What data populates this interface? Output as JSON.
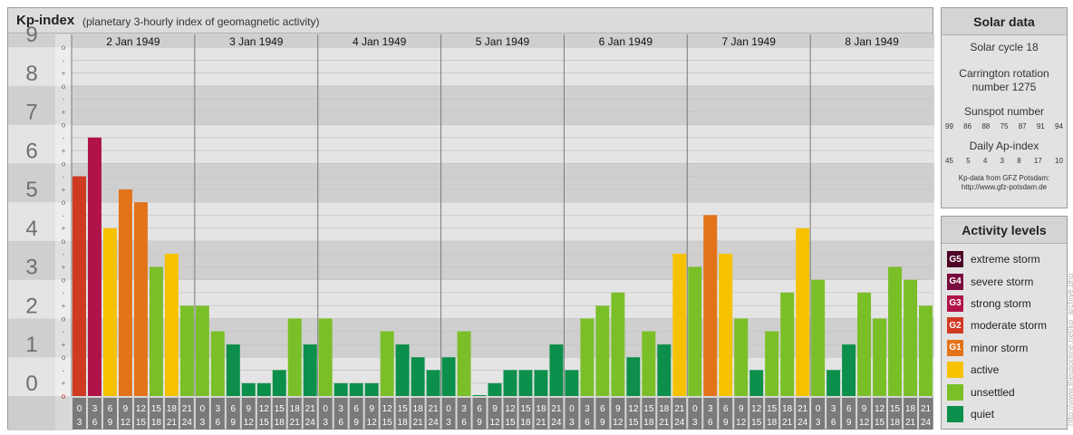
{
  "header": {
    "title": "Kp-index",
    "subtitle": "(planetary 3-hourly index of geomagnetic activity)"
  },
  "chart_data": {
    "type": "bar",
    "y_major_labels": [
      "0",
      "1",
      "2",
      "3",
      "4",
      "5",
      "6",
      "7",
      "8",
      "9"
    ],
    "y_minor_labels": [
      "o",
      "+",
      "-",
      "o",
      "+",
      "-",
      "o",
      "+",
      "-",
      "o",
      "+",
      "-",
      "o",
      "+",
      "-",
      "o",
      "+",
      "-",
      "o",
      "+",
      "-",
      "o",
      "+",
      "-",
      "o",
      "+",
      "-",
      "o"
    ],
    "ylim": [
      0,
      9.33
    ],
    "days": [
      "2 Jan 1949",
      "3 Jan 1949",
      "4 Jan 1949",
      "5 Jan 1949",
      "6 Jan 1949",
      "7 Jan 1949",
      "8 Jan 1949"
    ],
    "interval_top": [
      "0",
      "3",
      "6",
      "9",
      "12",
      "15",
      "18",
      "21"
    ],
    "interval_bottom": [
      "3",
      "6",
      "9",
      "12",
      "15",
      "18",
      "21",
      "24"
    ],
    "values": [
      [
        5.67,
        6.67,
        4.33,
        5.33,
        5.0,
        3.33,
        3.67,
        2.33
      ],
      [
        2.33,
        1.67,
        1.33,
        0.33,
        0.33,
        0.67,
        2.0,
        1.33
      ],
      [
        2.0,
        0.33,
        0.33,
        0.33,
        1.67,
        1.33,
        1.0,
        0.67
      ],
      [
        1.0,
        1.67,
        0.0,
        0.33,
        0.67,
        0.67,
        0.67,
        1.33
      ],
      [
        0.67,
        2.0,
        2.33,
        2.67,
        1.0,
        1.67,
        1.33,
        3.67
      ],
      [
        3.33,
        4.67,
        3.67,
        2.0,
        0.67,
        1.67,
        2.67,
        4.33
      ],
      [
        3.0,
        0.67,
        1.33,
        2.67,
        2.0,
        3.33,
        3.0,
        2.33
      ]
    ],
    "level_colors": {
      "quiet": "#0b8f4a",
      "unsettled": "#7bbf28",
      "active": "#f6c200",
      "minor": "#e37319",
      "moderate": "#d13a22",
      "strong": "#b0134a",
      "severe": "#7a0b3e",
      "extreme": "#4d0326"
    }
  },
  "solar_data": {
    "title": "Solar data",
    "cycle": "Solar cycle 18",
    "carrington_line1": "Carrington rotation",
    "carrington_line2": "number 1275",
    "sunspot_title": "Sunspot number",
    "sunspot_values": [
      "99",
      "86",
      "88",
      "75",
      "87",
      "91",
      "94"
    ],
    "ap_title": "Daily Ap-index",
    "ap_values": [
      "45",
      "5",
      "4",
      "3",
      "8",
      "17",
      "10"
    ],
    "credit_line1": "Kp-data from GFZ Potsdam:",
    "credit_line2": "http://www.gfz-potsdam.de"
  },
  "activity_levels": {
    "title": "Activity levels",
    "items": [
      {
        "code": "G5",
        "label": "extreme storm",
        "color": "#4d0326"
      },
      {
        "code": "G4",
        "label": "severe storm",
        "color": "#7a0b3e"
      },
      {
        "code": "G3",
        "label": "strong storm",
        "color": "#b0134a"
      },
      {
        "code": "G2",
        "label": "moderate storm",
        "color": "#d13a22"
      },
      {
        "code": "G1",
        "label": "minor storm",
        "color": "#e37319"
      },
      {
        "code": "",
        "label": "active",
        "color": "#f6c200"
      },
      {
        "code": "",
        "label": "unsettled",
        "color": "#7bbf28"
      },
      {
        "code": "",
        "label": "quiet",
        "color": "#0b8f4a"
      }
    ]
  },
  "watermark": "http://www.theusonline.net/kp_archive.php"
}
